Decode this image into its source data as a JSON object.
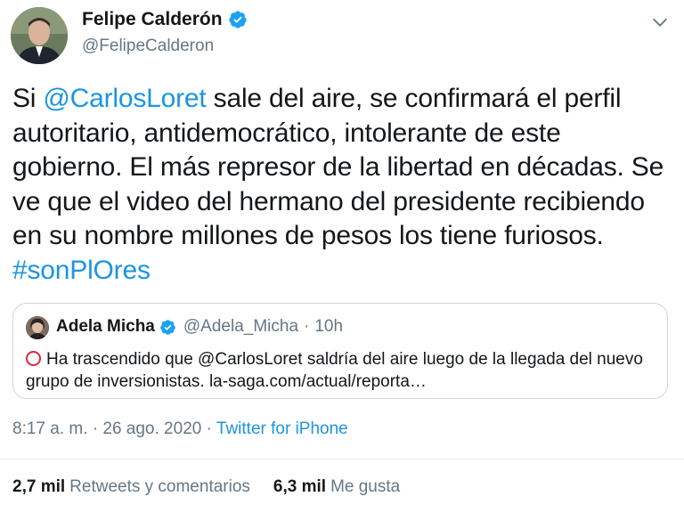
{
  "author": {
    "name": "Felipe Calderón",
    "handle": "@FelipeCalderon"
  },
  "tweet": {
    "text_segments": [
      {
        "text": "Si ",
        "link": false
      },
      {
        "text": "@CarlosLoret",
        "link": true
      },
      {
        "text": " sale del aire, se confirmará el perfil autoritario, antidemocrático, intolerante de este gobierno. El más represor de la libertad en décadas. Se ve que el video del hermano del presidente recibiendo en su nombre millones de pesos los tiene furiosos. ",
        "link": false
      },
      {
        "text": "#sonPlOres",
        "link": true
      }
    ]
  },
  "quoted": {
    "name": "Adela Micha",
    "handle": "@Adela_Micha",
    "separator": "·",
    "time": "10h",
    "text": "Ha trascendido que @CarlosLoret  saldría del aire luego de la llegada del nuevo grupo de inversionistas. la-saga.com/actual/reporta…"
  },
  "meta": {
    "time": "8:17 a. m.",
    "separator": "·",
    "date": "26 ago. 2020",
    "app": "Twitter for iPhone"
  },
  "stats": {
    "retweets_count": "2,7 mil",
    "retweets_label": "Retweets y comentarios",
    "likes_count": "6,3 mil",
    "likes_label": "Me gusta"
  },
  "icons": {
    "verified": "verified-badge-icon",
    "chevron": "chevron-down-icon",
    "ring": "red-circle-icon"
  },
  "colors": {
    "link": "#1b95e0",
    "secondary_text": "#657786",
    "verified": "#1da1f2",
    "ring": "#e0263b"
  }
}
